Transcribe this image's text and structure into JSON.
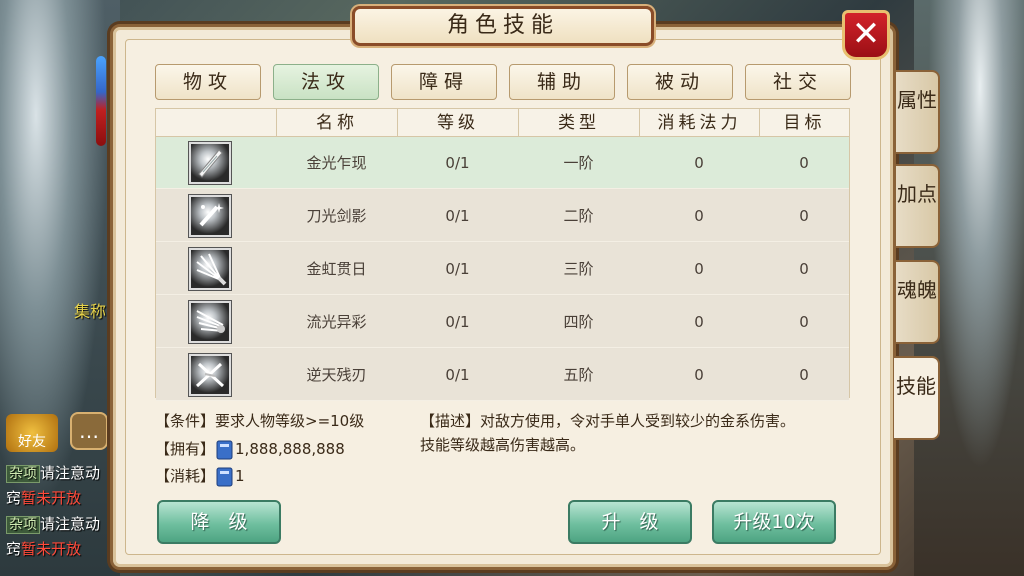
{
  "window": {
    "title": "角色技能",
    "close_glyph": "✕"
  },
  "top_tabs": [
    {
      "label": "物攻",
      "active": false
    },
    {
      "label": "法攻",
      "active": true
    },
    {
      "label": "障碍",
      "active": false
    },
    {
      "label": "辅助",
      "active": false
    },
    {
      "label": "被动",
      "active": false
    },
    {
      "label": "社交",
      "active": false
    }
  ],
  "table": {
    "headers": [
      "",
      "名称",
      "等级",
      "类型",
      "消耗法力",
      "目标"
    ],
    "rows": [
      {
        "icon": "sword-blade-icon",
        "name": "金光乍现",
        "level": "0/1",
        "type": "一阶",
        "mana": "0",
        "target": "0",
        "selected": true
      },
      {
        "icon": "sparkle-blade-icon",
        "name": "刀光剑影",
        "level": "0/1",
        "type": "二阶",
        "mana": "0",
        "target": "0",
        "selected": false
      },
      {
        "icon": "burst-sword-icon",
        "name": "金虹贯日",
        "level": "0/1",
        "type": "三阶",
        "mana": "0",
        "target": "0",
        "selected": false
      },
      {
        "icon": "fan-blades-icon",
        "name": "流光异彩",
        "level": "0/1",
        "type": "四阶",
        "mana": "0",
        "target": "0",
        "selected": false
      },
      {
        "icon": "crossed-blades-icon",
        "name": "逆天残刃",
        "level": "0/1",
        "type": "五阶",
        "mana": "0",
        "target": "0",
        "selected": false
      }
    ]
  },
  "info": {
    "condition": "【条件】要求人物等级>=10级",
    "owned_label": "【拥有】",
    "owned_value": "1,888,888,888",
    "cost_label": "【消耗】",
    "cost_value": "1",
    "description_line1": "【描述】对敌方使用，令对手单人受到较少的金系伤害。",
    "description_line2": "技能等级越高伤害越高。"
  },
  "buttons": {
    "downgrade": "降　级",
    "upgrade": "升　级",
    "upgrade10": "升级10次"
  },
  "side_tabs": [
    {
      "label": "属性",
      "active": false
    },
    {
      "label": "加点",
      "active": false
    },
    {
      "label": "魂魄",
      "active": false
    },
    {
      "label": "技能",
      "active": true
    }
  ],
  "chat": {
    "lines": [
      {
        "tag": "杂项",
        "text": "请注意动",
        "extra": ""
      },
      {
        "tag": "",
        "text": "窍",
        "extra": "暂未开放"
      },
      {
        "tag": "杂项",
        "text": "请注意动",
        "extra": ""
      },
      {
        "tag": "",
        "text": "窍",
        "extra": "暂未开放"
      }
    ],
    "friend_label": "好友",
    "gather_text": "集称"
  },
  "colors": {
    "accent_green": "#6fbf9f",
    "close_red": "#c41a22",
    "panel_bg": "#f3ead8",
    "selected_row": "#dcebd9"
  }
}
